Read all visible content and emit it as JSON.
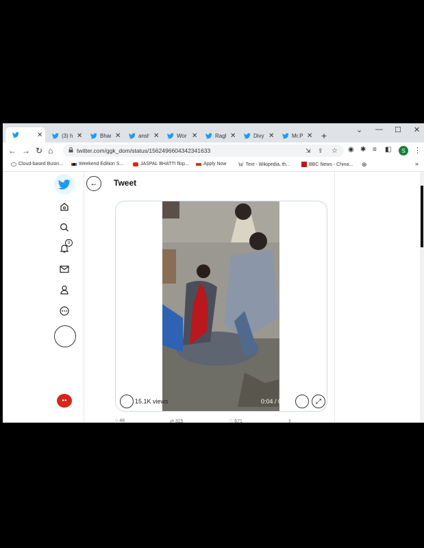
{
  "browser": {
    "tabs": [
      {
        "label": "",
        "active": true
      },
      {
        "label": "(3) h"
      },
      {
        "label": "Bhar"
      },
      {
        "label": "ansh"
      },
      {
        "label": "Wor"
      },
      {
        "label": "Ragh"
      },
      {
        "label": "Divy"
      },
      {
        "label": "Mr.P"
      }
    ],
    "url": "twitter.com/ggk_dom/status/1562496604342341633",
    "profile_initial": "S",
    "bookmarks": [
      "Cloud-based Busin...",
      "Weekend Edition S...",
      "JASPAL BHATTI flop...",
      "Apply Now",
      "Text - Wikipedia, th...",
      "BBC News - China..."
    ],
    "bookmarks_more": "»"
  },
  "twitter": {
    "header_title": "Tweet",
    "notification_count": "3",
    "video": {
      "views": "15.1K views",
      "time": "0:04 / 0:36"
    },
    "actions": {
      "replies": "48",
      "retweets": "315",
      "likes": "671"
    }
  },
  "colors": {
    "twitter_blue": "#1d9bf0",
    "chrome_tabbar": "#dfe3e8",
    "profile_green": "#188038",
    "youtube_red": "#e62117"
  }
}
